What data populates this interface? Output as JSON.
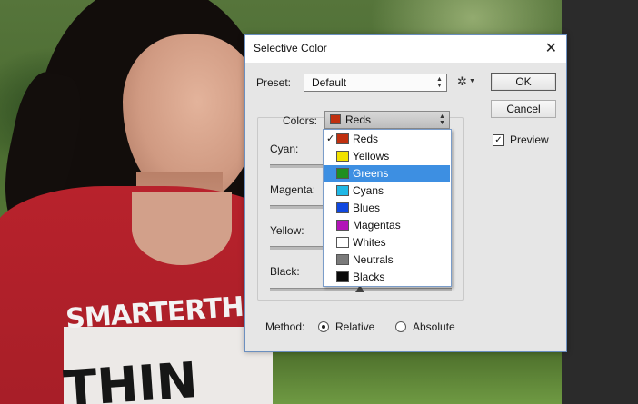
{
  "dialog": {
    "title": "Selective Color",
    "preset_label": "Preset:",
    "preset_value": "Default",
    "ok_label": "OK",
    "cancel_label": "Cancel",
    "preview_label": "Preview",
    "preview_checked": true,
    "colors_label": "Colors:",
    "colors_value": "Reds",
    "sliders": [
      {
        "label": "Cyan:"
      },
      {
        "label": "Magenta:"
      },
      {
        "label": "Yellow:"
      },
      {
        "label": "Black:"
      }
    ],
    "method_label": "Method:",
    "method_options": [
      {
        "label": "Relative",
        "selected": true
      },
      {
        "label": "Absolute",
        "selected": false
      }
    ]
  },
  "dropdown": {
    "selected": "Reds",
    "highlighted": "Greens",
    "options": [
      {
        "label": "Reds",
        "color": "#c0300f"
      },
      {
        "label": "Yellows",
        "color": "#f2e200"
      },
      {
        "label": "Greens",
        "color": "#1f8f1f"
      },
      {
        "label": "Cyans",
        "color": "#1fb8e6"
      },
      {
        "label": "Blues",
        "color": "#1048e0"
      },
      {
        "label": "Magentas",
        "color": "#b214b8"
      },
      {
        "label": "Whites",
        "color": "#ffffff"
      },
      {
        "label": "Neutrals",
        "color": "#7a7a7a"
      },
      {
        "label": "Blacks",
        "color": "#0a0a0a"
      }
    ]
  },
  "photo": {
    "shirt_text_line1": "SMARTERTHAN YO",
    "shirt_text_line2": "THIN"
  },
  "icons": {
    "gear": "gear-icon",
    "close": "close-icon",
    "checkmark": "checkmark-icon"
  }
}
